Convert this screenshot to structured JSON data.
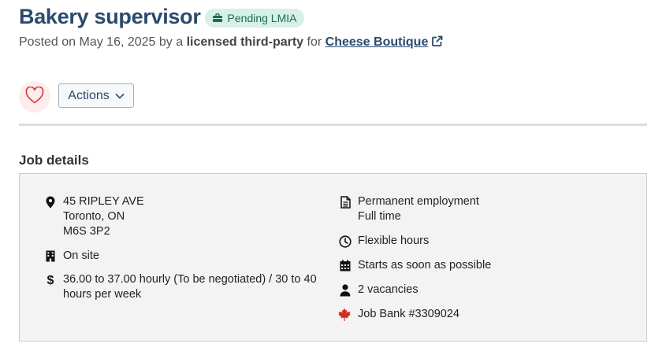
{
  "header": {
    "title": "Bakery supervisor",
    "badge_label": "Pending LMIA",
    "posted_prefix": "Posted on May 16, 2025 by a",
    "poster_type": "licensed third-party",
    "posted_for": "for",
    "employer_name": "Cheese Boutique"
  },
  "actions": {
    "favourite_icon": "heart-icon",
    "actions_label": "Actions"
  },
  "job_details": {
    "heading": "Job details",
    "address": {
      "line1": "45 RIPLEY AVE",
      "line2": "Toronto, ON",
      "line3": "M6S 3P2"
    },
    "work_location": "On site",
    "salary": "36.00 to 37.00 hourly (To be negotiated) / 30 to 40 hours per week",
    "employment_terms": {
      "line1": "Permanent employment",
      "line2": "Full time"
    },
    "hours": "Flexible hours",
    "start": "Starts as soon as possible",
    "vacancies": "2 vacancies",
    "job_bank": "Job Bank #3309024"
  },
  "colors": {
    "title": "#2b4a6e",
    "badge_bg": "#d7f0e8",
    "badge_text": "#1d6b54",
    "heart": "#d33a3a",
    "maple_leaf": "#d52b1e",
    "panel_bg": "#f3f3f3"
  }
}
